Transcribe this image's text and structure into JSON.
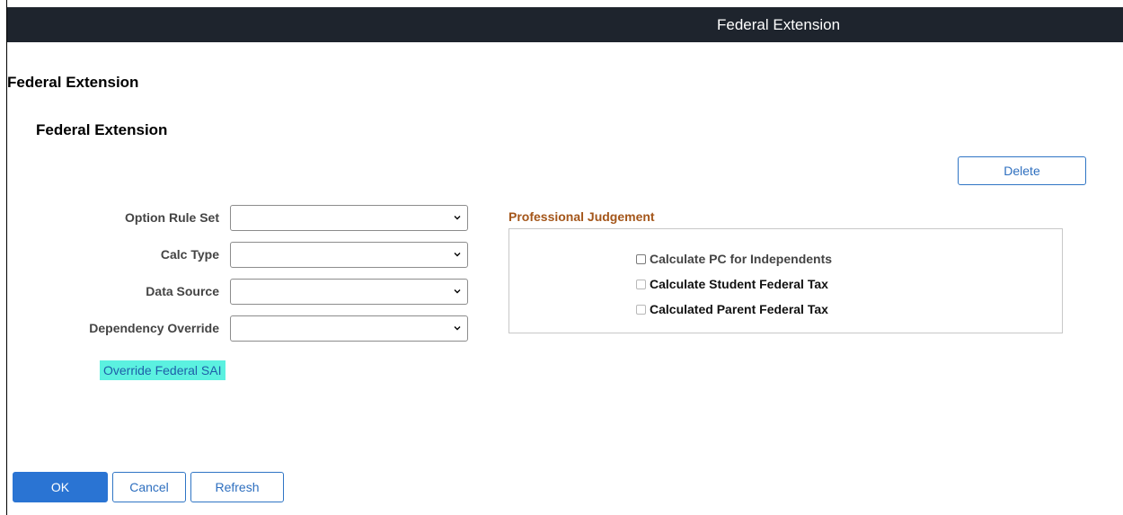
{
  "window": {
    "title": "Federal Extension"
  },
  "page": {
    "heading": "Federal Extension",
    "section_heading": "Federal Extension"
  },
  "actions": {
    "delete_label": "Delete"
  },
  "form": {
    "fields": [
      {
        "label": "Option Rule Set",
        "value": ""
      },
      {
        "label": "Calc Type",
        "value": ""
      },
      {
        "label": "Data Source",
        "value": ""
      },
      {
        "label": "Dependency Override",
        "value": ""
      }
    ],
    "override_link": "Override Federal SAI"
  },
  "professional_judgement": {
    "heading": "Professional Judgement",
    "options": [
      {
        "label": "Calculate PC for Independents",
        "checked": false
      },
      {
        "label": "Calculate Student Federal Tax",
        "checked": false
      },
      {
        "label": "Calculated Parent Federal Tax",
        "checked": false
      }
    ]
  },
  "footer": {
    "ok_label": "OK",
    "cancel_label": "Cancel",
    "refresh_label": "Refresh"
  },
  "colors": {
    "title_bar": "#1e242d",
    "primary": "#2a74d3",
    "link_highlight": "#5bf1e0",
    "section_accent": "#a4561a"
  },
  "icons": {
    "select_toggle": "chevron-down-icon"
  }
}
